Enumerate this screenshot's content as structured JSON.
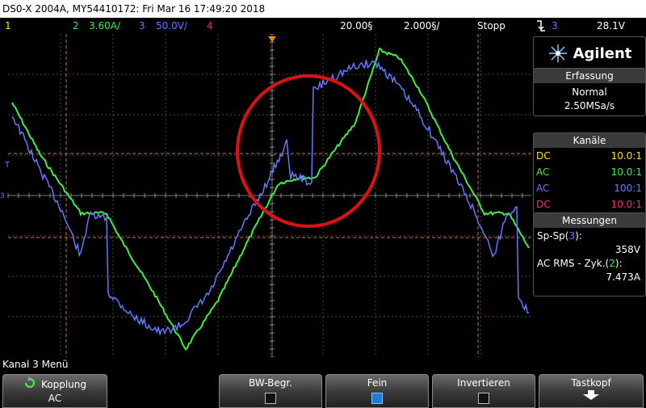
{
  "header": {
    "title": "DS0-X 2004A, MY54410172: Fri Mar 16 17:49:20 2018"
  },
  "channel_bar": {
    "ch1_num": "1",
    "ch2_num": "2",
    "ch2_scale": "3.60A/",
    "ch3_num": "3",
    "ch3_scale": "50.0V/",
    "ch4_num": "4",
    "timebase": "20.00§",
    "delay": "2.000§/",
    "run_state": "Stopp",
    "trigger_icon": "trigger-edge-falling-icon",
    "trigger_level": "28.1V"
  },
  "brand": {
    "logo": "agilent-spark-logo",
    "name": "Agilent"
  },
  "acquisition": {
    "heading": "Erfassung",
    "mode": "Normal",
    "rate": "2.50MSa/s"
  },
  "channels": {
    "heading": "Kanäle",
    "rows": [
      {
        "coupling": "DC",
        "ratio": "10.0:1",
        "color": "#ffe400"
      },
      {
        "coupling": "AC",
        "ratio": "10.0:1",
        "color": "#3cf03c"
      },
      {
        "coupling": "AC",
        "ratio": "100:1",
        "color": "#5f7bff"
      },
      {
        "coupling": "DC",
        "ratio": "10.0:1",
        "color": "#ff2a6e"
      }
    ]
  },
  "measurements": {
    "heading": "Messungen",
    "m1_label": "Sp-Sp(",
    "m1_ch": "3",
    "m1_close": "):",
    "m1_value": "358V",
    "m2_label": "AC RMS - Zyk.(",
    "m2_ch": "2",
    "m2_close": "):",
    "m2_value": "7.473A"
  },
  "menu": {
    "title": "Kanal 3 Menü",
    "softkeys": [
      {
        "label": "Kopplung",
        "value": "AC",
        "icon": "rotate-knob-icon"
      },
      {
        "label": "BW-Begr.",
        "checked": false
      },
      {
        "label": "Fein",
        "checked": true
      },
      {
        "label": "Invertieren",
        "checked": false
      },
      {
        "label": "Tastkopf",
        "icon": "arrow-down-icon"
      }
    ]
  },
  "colors": {
    "ch1": "#ffe400",
    "ch2": "#3cf03c",
    "ch3": "#5f7bff",
    "ch4": "#ff2a6e",
    "grid": "#555555",
    "cursor": "#d07040",
    "highlight_circle": "#e01010"
  }
}
